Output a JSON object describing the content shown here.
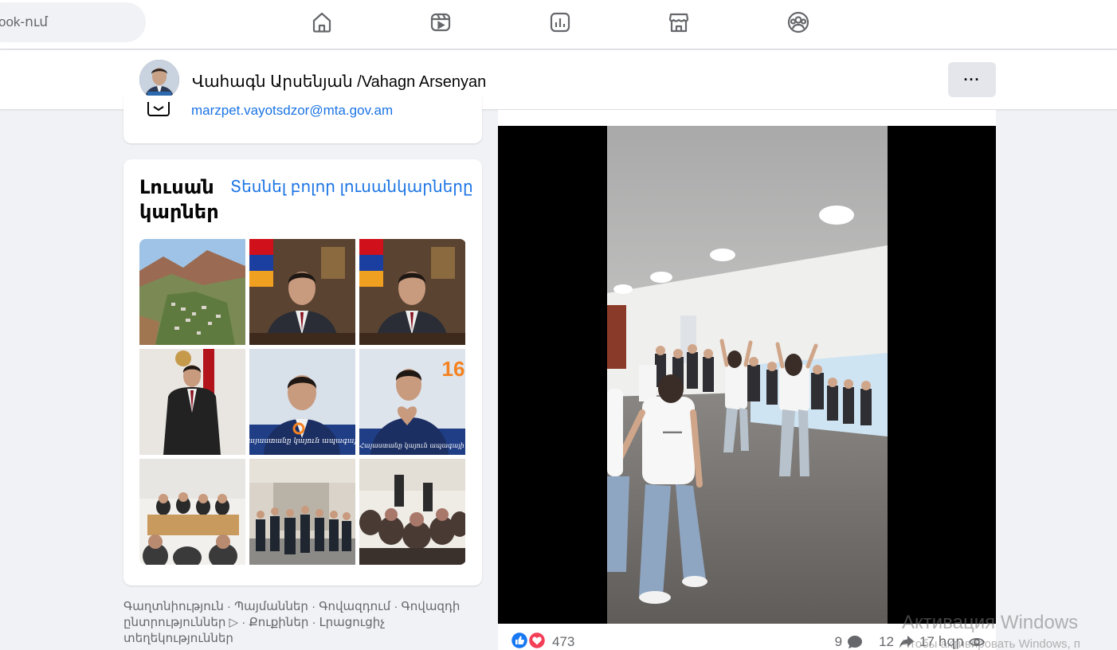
{
  "topnav": {
    "search_text": "ook-ում",
    "icons": [
      "home-icon",
      "video-icon",
      "stats-icon",
      "marketplace-icon",
      "groups-icon"
    ]
  },
  "profile": {
    "name": "Վահագն Արսենյան /Vahagn Arsenyan",
    "more_label": "···"
  },
  "intro": {
    "email": "marzpet.vayotsdzor@mta.gov.am"
  },
  "photos": {
    "title": "Լուսանկարներ",
    "title_line1": "Լուսան",
    "title_line2": "կարներ",
    "see_all": "Տեսնել բոլոր լուսանկարները",
    "overlay_badge": "16",
    "overlay_caption": "Հայաստանը կայուն ապագայի"
  },
  "footer": {
    "text": "Գաղտնիություն · Պայմաններ · Գովազդում · Գովազդի ընտրություններ ▷ · Քուքիներ · Լրացուցիչ տեղեկություններ"
  },
  "post": {
    "reaction_count": "473",
    "comments": "9",
    "shares": "12",
    "views": "17 հզր"
  },
  "system": {
    "watermark_title": "Активация Windows",
    "watermark_sub": "Чтобы активировать Windows, п"
  },
  "colors": {
    "link": "#1b74e4",
    "background": "#f0f2f5",
    "like": "#1877f2",
    "love": "#f33e58"
  }
}
